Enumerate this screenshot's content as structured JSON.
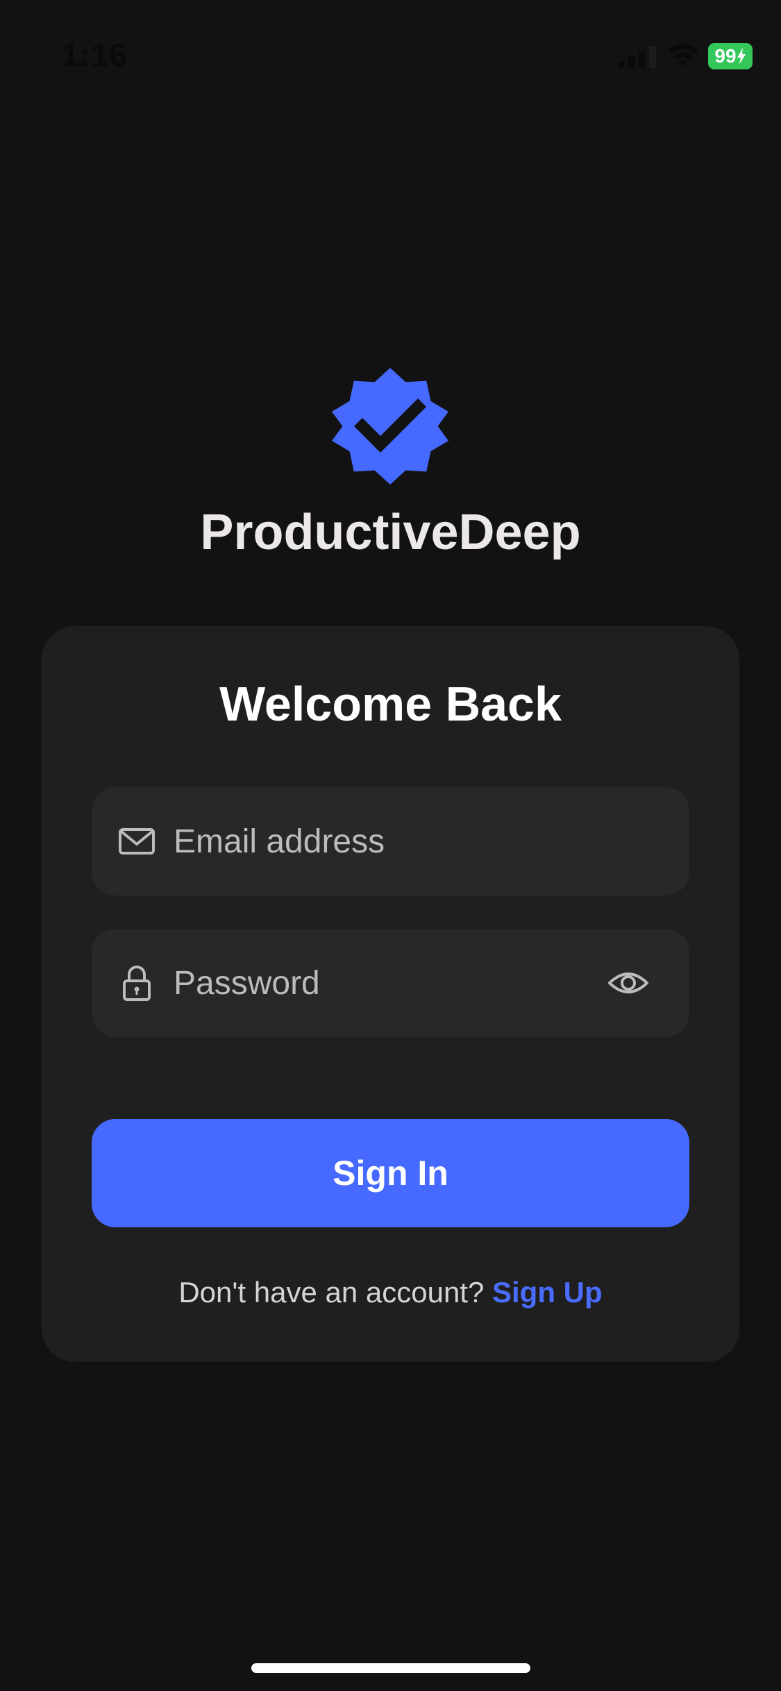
{
  "status_bar": {
    "time": "1:16",
    "battery": "99",
    "signal_icon": "cellular-signal-icon",
    "wifi_icon": "wifi-icon"
  },
  "brand": {
    "logo_icon": "verified-badge-check-icon",
    "name": "ProductiveDeep",
    "accent_color": "#4669ff"
  },
  "login_card": {
    "title": "Welcome Back",
    "email": {
      "icon": "mail-icon",
      "placeholder": "Email address",
      "value": ""
    },
    "password": {
      "icon": "lock-icon",
      "placeholder": "Password",
      "value": "",
      "toggle_icon": "eye-icon"
    },
    "signin_label": "Sign In",
    "signup_prompt": "Don't have an account?",
    "signup_link": "Sign Up"
  }
}
